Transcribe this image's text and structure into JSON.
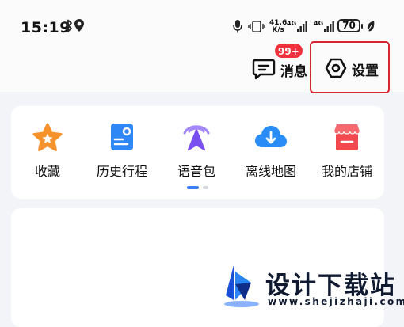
{
  "status_bar": {
    "time": "15:19",
    "net_speed_value": "41.6",
    "net_speed_unit": "K/s",
    "sim1_label": "4G",
    "sim2_label": "4G",
    "battery": "70",
    "icons": [
      "bluetooth-icon",
      "location-icon",
      "microphone-icon",
      "vibrate-icon",
      "signal-icon",
      "battery-icon",
      "leaf-icon"
    ]
  },
  "header": {
    "messages_label": "消息",
    "messages_badge": "99+",
    "settings_label": "设置",
    "highlight_color": "#d52531"
  },
  "tools": [
    {
      "label": "收藏",
      "icon": "star-icon",
      "color": "#f5922b"
    },
    {
      "label": "历史行程",
      "icon": "history-card-icon",
      "color": "#2f86f5"
    },
    {
      "label": "语音包",
      "icon": "voice-navigation-icon",
      "color": "#7a4ff0"
    },
    {
      "label": "离线地图",
      "icon": "cloud-download-icon",
      "color": "#2a8cf6"
    },
    {
      "label": "我的店铺",
      "icon": "shop-icon",
      "color": "#f2494e"
    }
  ],
  "pager": {
    "pages": 2,
    "current": 1,
    "accent": "#3a7ff6"
  },
  "watermark": {
    "title": "设计下载站",
    "url": "www.shejizhaji.com"
  }
}
